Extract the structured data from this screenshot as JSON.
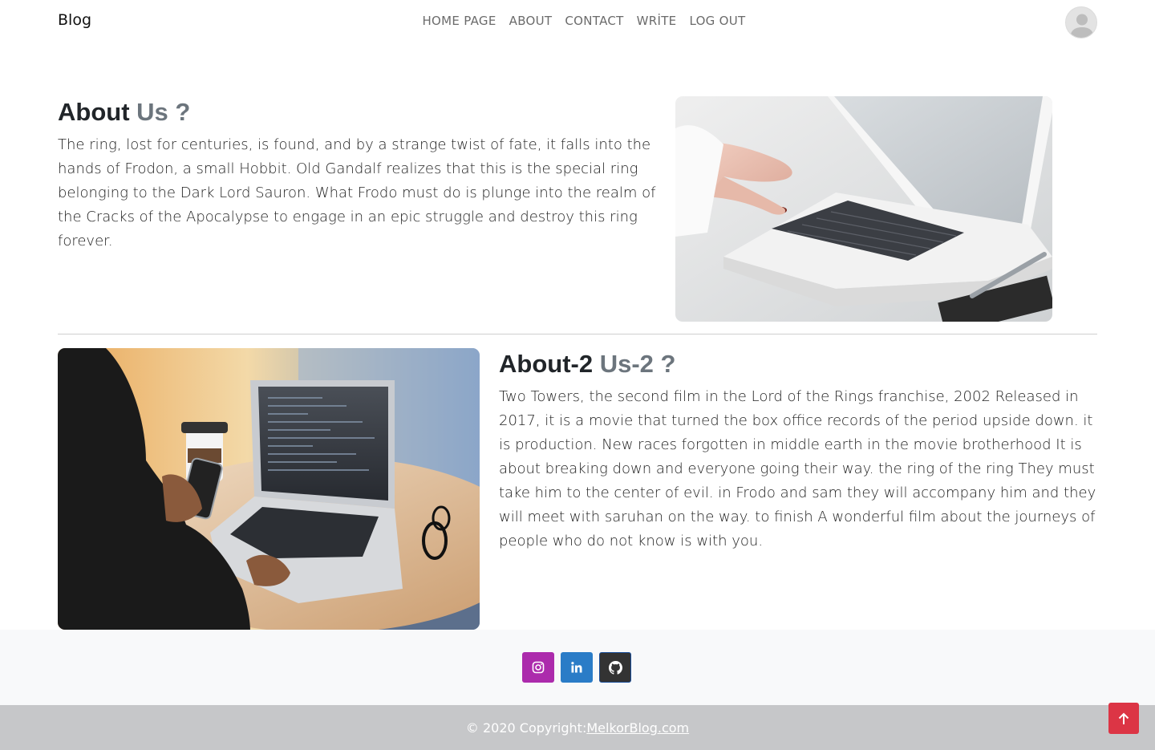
{
  "nav": {
    "brand": "Blog",
    "links": [
      "HOME PAGE",
      "ABOUT",
      "CONTACT",
      "WRİTE",
      "LOG OUT"
    ]
  },
  "section1": {
    "title_main": "About",
    "title_accent": "Us ?",
    "text": "The ring, lost for centuries, is found, and by a strange twist of fate, it falls into the hands of Frodon, a small Hobbit. Old Gandalf realizes that this is the special ring belonging to the Dark Lord Sauron. What Frodo must do is plunge into the realm of the Cracks of the Apocalypse to engage in an epic struggle and destroy this ring forever."
  },
  "section2": {
    "title_main": "About-2",
    "title_accent": "Us-2 ?",
    "text": "Two Towers, the second film in the Lord of the Rings franchise, 2002 Released in 2017, it is a movie that turned the box office records of the period upside down. it is production. New races forgotten in middle earth in the movie brotherhood It is about breaking down and everyone going their way. the ring of the ring They must take him to the center of evil. in Frodo and sam they will accompany him and they will meet with saruhan on the way. to finish A wonderful film about the journeys of people who do not know is with you."
  },
  "footer": {
    "copyright": "© 2020 Copyright:",
    "site_link": "MelkorBlog.com",
    "social": [
      "instagram-icon",
      "linkedin-icon",
      "github-icon"
    ]
  },
  "colors": {
    "instagram": "#ac2bac",
    "linkedin": "#2a7cc7",
    "github": "#333333",
    "back_to_top": "#dc3545",
    "accent_text": "#6c757d"
  }
}
